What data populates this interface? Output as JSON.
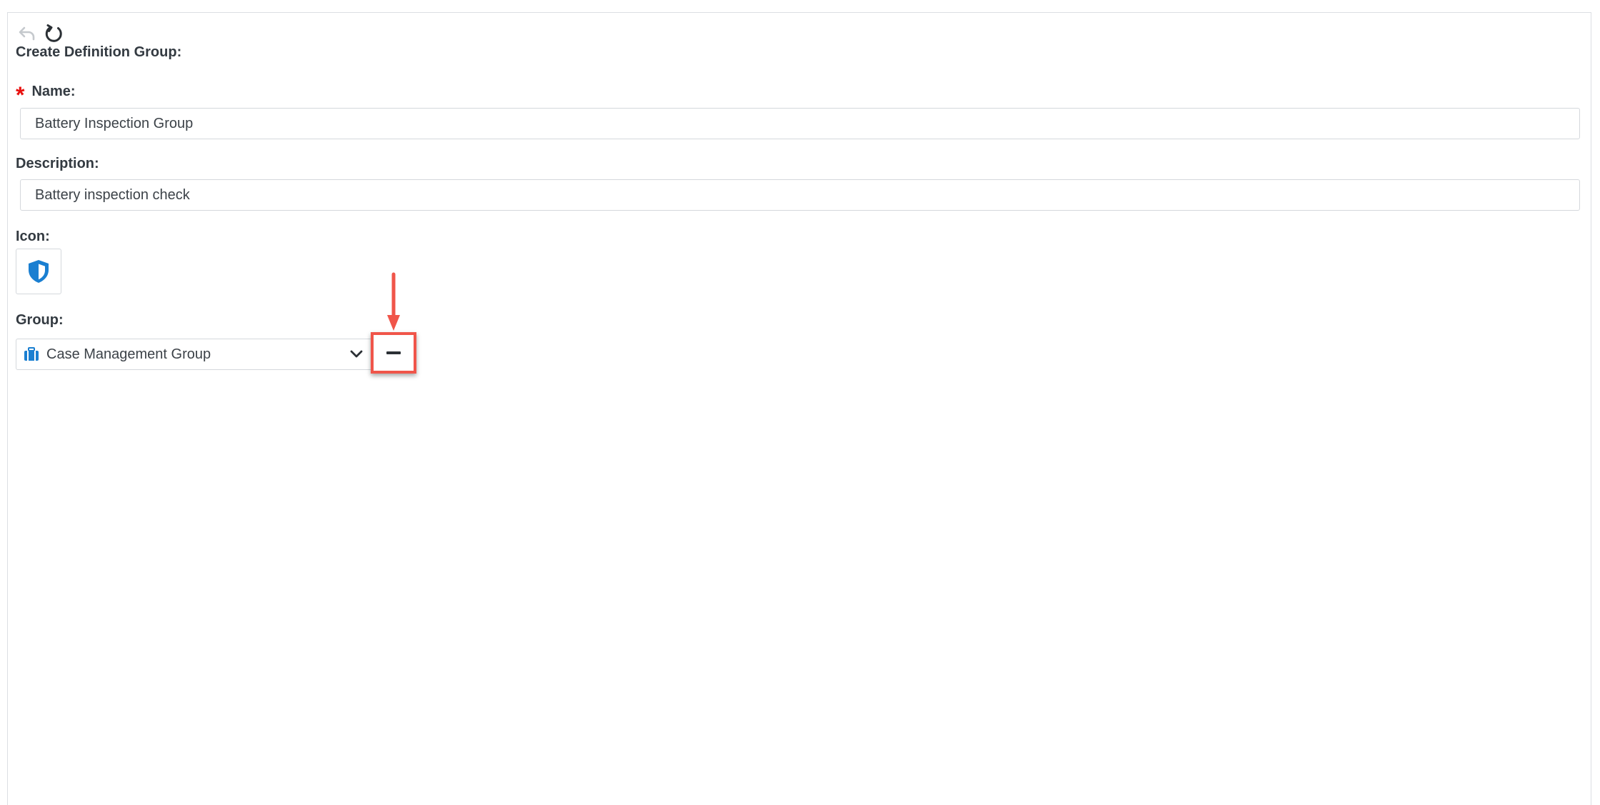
{
  "form": {
    "title": "Create Definition Group:",
    "name_label": "Name:",
    "name_required_marker": "*",
    "name_value": "Battery Inspection Group",
    "description_label": "Description:",
    "description_value": "Battery inspection check",
    "icon_label": "Icon:",
    "icon_name": "shield-icon",
    "group_label": "Group:",
    "group_selected": "Case Management Group",
    "group_icon_name": "briefcase-icon"
  },
  "toolbar": {
    "undo_icon": "undo-icon",
    "refresh_icon": "refresh-icon"
  },
  "colors": {
    "required": "#e8100e",
    "accent_blue": "#1a7fd1",
    "highlight": "#f0554a"
  }
}
